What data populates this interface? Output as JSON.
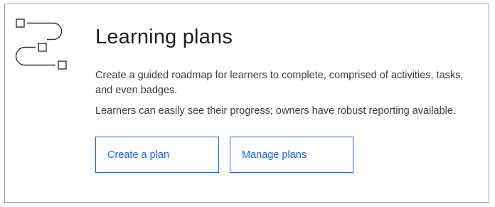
{
  "card": {
    "icon": "learning-path-icon",
    "title": "Learning plans",
    "description": "Create a guided roadmap for learners to complete, comprised of activities, tasks, and even badges.",
    "reporting_note": "Learners can easily see their progress; owners have robust reporting available.",
    "buttons": {
      "create_label": "Create a plan",
      "manage_label": "Manage plans"
    }
  },
  "colors": {
    "accent": "#0f62fe",
    "title_text": "#1f1f1f",
    "body_text": "#3d3d3d",
    "border": "#9e9e9e",
    "icon_stroke": "#333333"
  }
}
